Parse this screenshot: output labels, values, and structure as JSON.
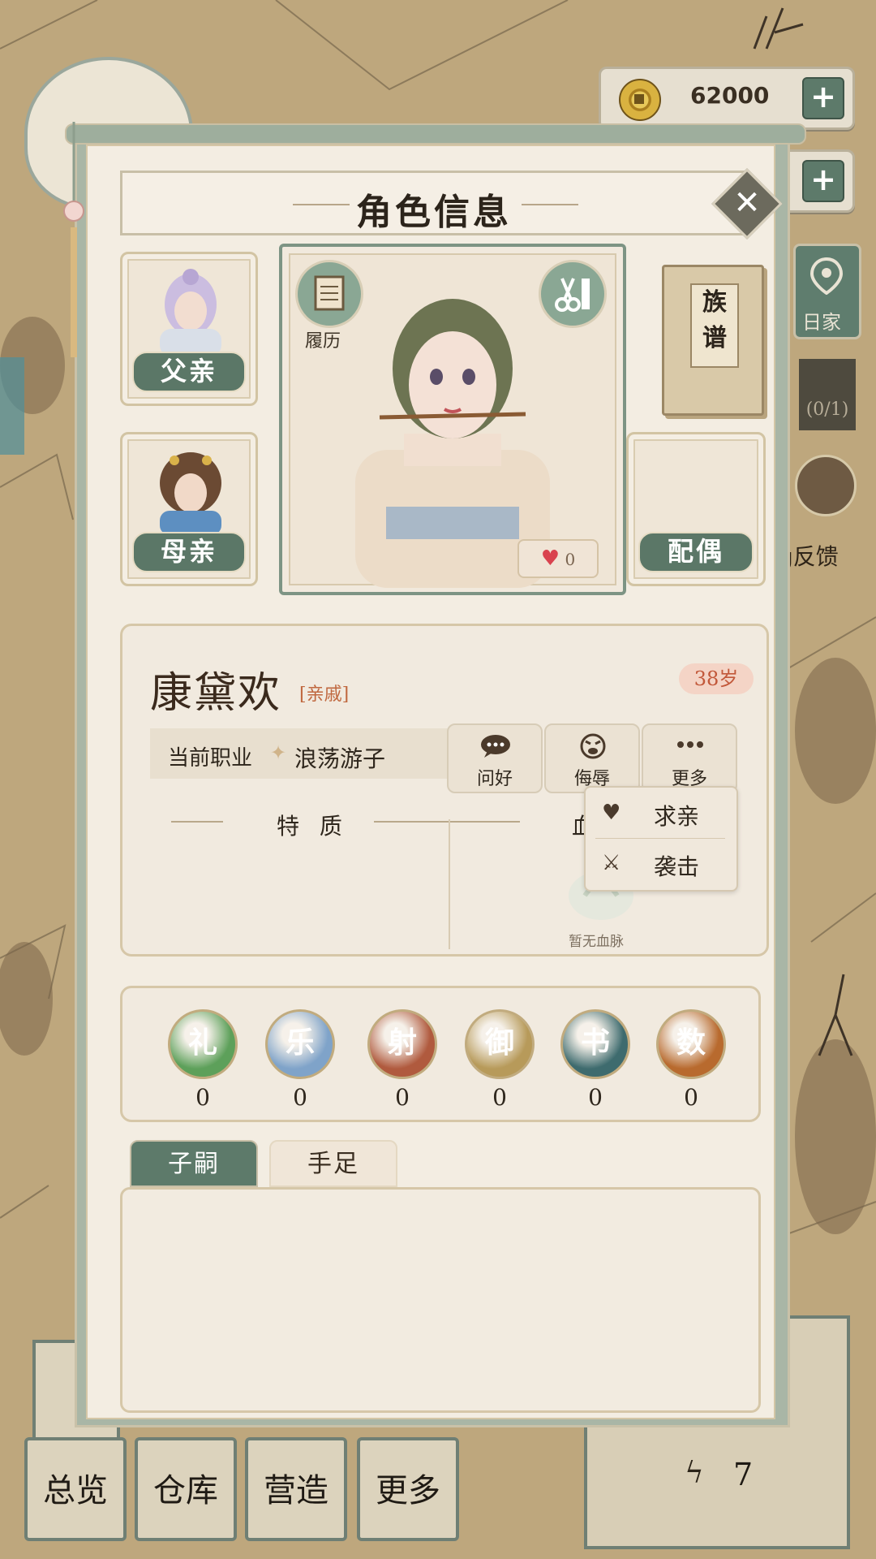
{
  "hud": {
    "coins": "62000",
    "side_location_label": "日家",
    "side_counter": "(0/1)",
    "side_feedback": "g反馈",
    "energy_value": "7"
  },
  "bottom_nav": {
    "items": [
      "总览",
      "仓库",
      "营造",
      "更多"
    ]
  },
  "dialog": {
    "title": "角色信息",
    "father_label": "父亲",
    "mother_label": "母亲",
    "spouse_label": "配偶",
    "resume_label": "履历",
    "heart_count": "0",
    "genealogy_label": "族谱",
    "character": {
      "name": "康黛欢",
      "relation": "[亲戚]",
      "age": "38岁",
      "job_label": "当前职业",
      "job_value": "浪荡游子"
    },
    "actions": {
      "greet": "问好",
      "insult": "侮辱",
      "more": "更多"
    },
    "dropdown": {
      "propose": "求亲",
      "attack": "袭击"
    },
    "traits_title": "特 质",
    "bloodline_title": "血",
    "no_bloodline": "暂无血脉",
    "skills": [
      {
        "name": "礼",
        "value": "0",
        "color": "#5da05a"
      },
      {
        "name": "乐",
        "value": "0",
        "color": "#7fa3c9"
      },
      {
        "name": "射",
        "value": "0",
        "color": "#b05a3e"
      },
      {
        "name": "御",
        "value": "0",
        "color": "#b79a5a"
      },
      {
        "name": "书",
        "value": "0",
        "color": "#3e6b6e"
      },
      {
        "name": "数",
        "value": "0",
        "color": "#b86a2e"
      }
    ],
    "tabs": {
      "heirs": "子嗣",
      "siblings": "手足"
    }
  },
  "colors": {
    "accent_green": "#5d7a6a",
    "paper": "#f3ede2",
    "age_badge": "#f4d4c6",
    "relation_text": "#c0683f"
  }
}
